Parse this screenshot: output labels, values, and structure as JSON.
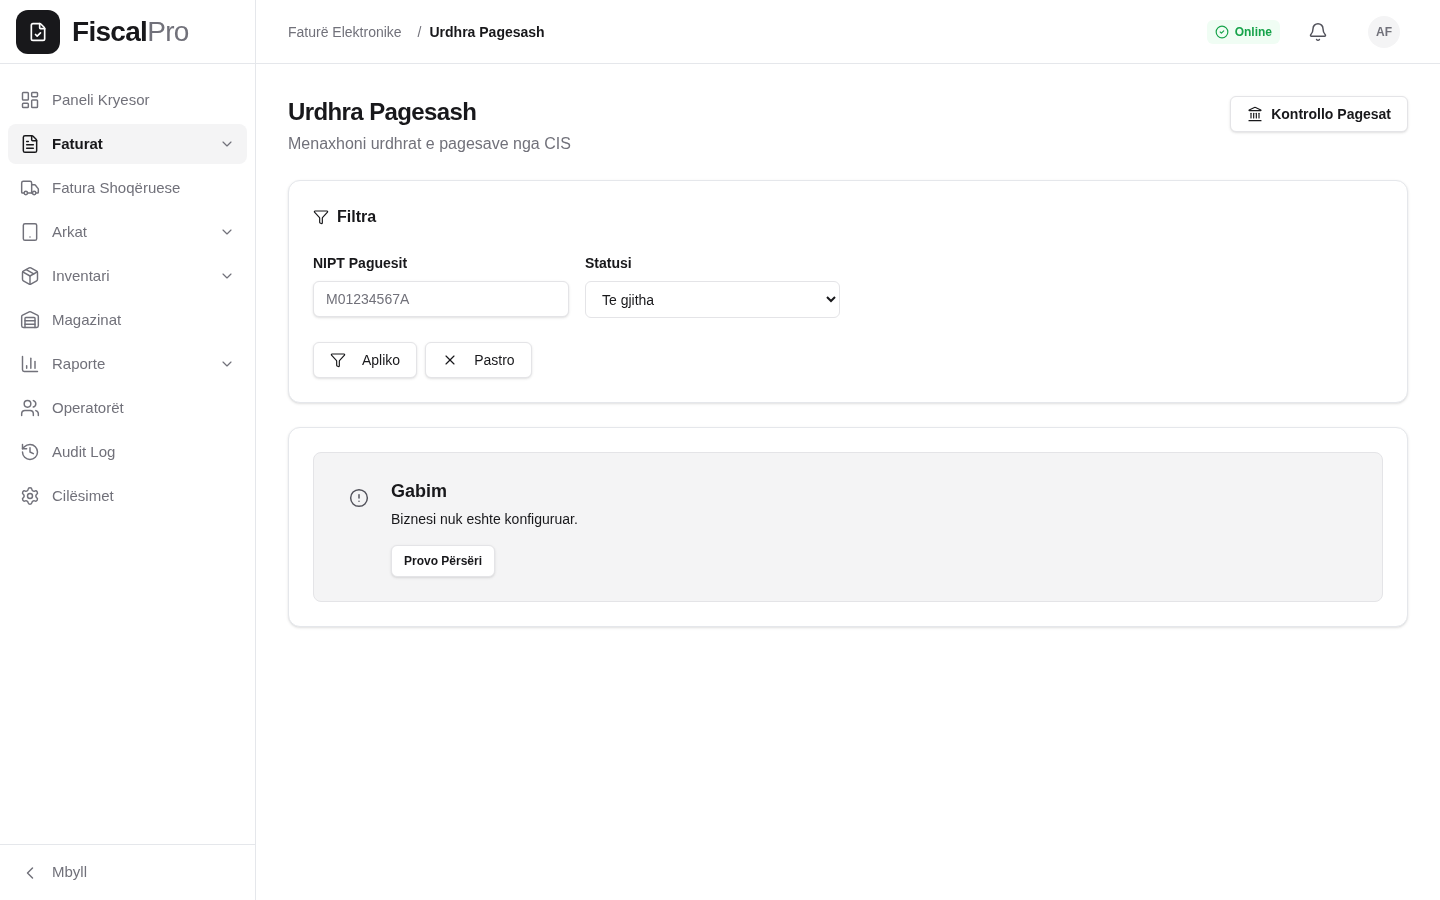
{
  "brand": {
    "strong": "Fiscal",
    "light": "Pro"
  },
  "sidebar": {
    "items": [
      {
        "label": "Paneli Kryesor",
        "selected": false,
        "has_submenu": false
      },
      {
        "label": "Faturat",
        "selected": true,
        "has_submenu": true
      },
      {
        "label": "Fatura Shoqëruese",
        "selected": false,
        "has_submenu": false
      },
      {
        "label": "Arkat",
        "selected": false,
        "has_submenu": true
      },
      {
        "label": "Inventari",
        "selected": false,
        "has_submenu": true
      },
      {
        "label": "Magazinat",
        "selected": false,
        "has_submenu": false
      },
      {
        "label": "Raporte",
        "selected": false,
        "has_submenu": true
      },
      {
        "label": "Operatorët",
        "selected": false,
        "has_submenu": false
      },
      {
        "label": "Audit Log",
        "selected": false,
        "has_submenu": false
      },
      {
        "label": "Cilësimet",
        "selected": false,
        "has_submenu": false
      }
    ],
    "collapse": {
      "label": "Mbyll"
    }
  },
  "header": {
    "breadcrumb": {
      "separator": "/",
      "items": [
        {
          "label": "Faturë Elektronike",
          "current": false
        },
        {
          "label": "Urdhra Pagesash",
          "current": true
        }
      ]
    },
    "status": {
      "label": "Online"
    },
    "avatar": "AF"
  },
  "page": {
    "title": "Urdhra Pagesash",
    "subtitle": "Menaxhoni urdhrat e pagesave nga CIS",
    "action": "Kontrollo Pagesat"
  },
  "filters": {
    "title": "Filtra",
    "fields": [
      {
        "kind": "text",
        "label": "NIPT Paguesit",
        "placeholder": "M01234567A"
      },
      {
        "kind": "select",
        "label": "Statusi",
        "value": "Te gjitha"
      }
    ],
    "buttons": [
      {
        "kind": "apply",
        "label": "Apliko"
      },
      {
        "kind": "clear",
        "label": "Pastro"
      }
    ]
  },
  "error": {
    "title": "Gabim",
    "message": "Biznesi nuk eshte konfiguruar.",
    "button": "Provo Përsëri"
  }
}
